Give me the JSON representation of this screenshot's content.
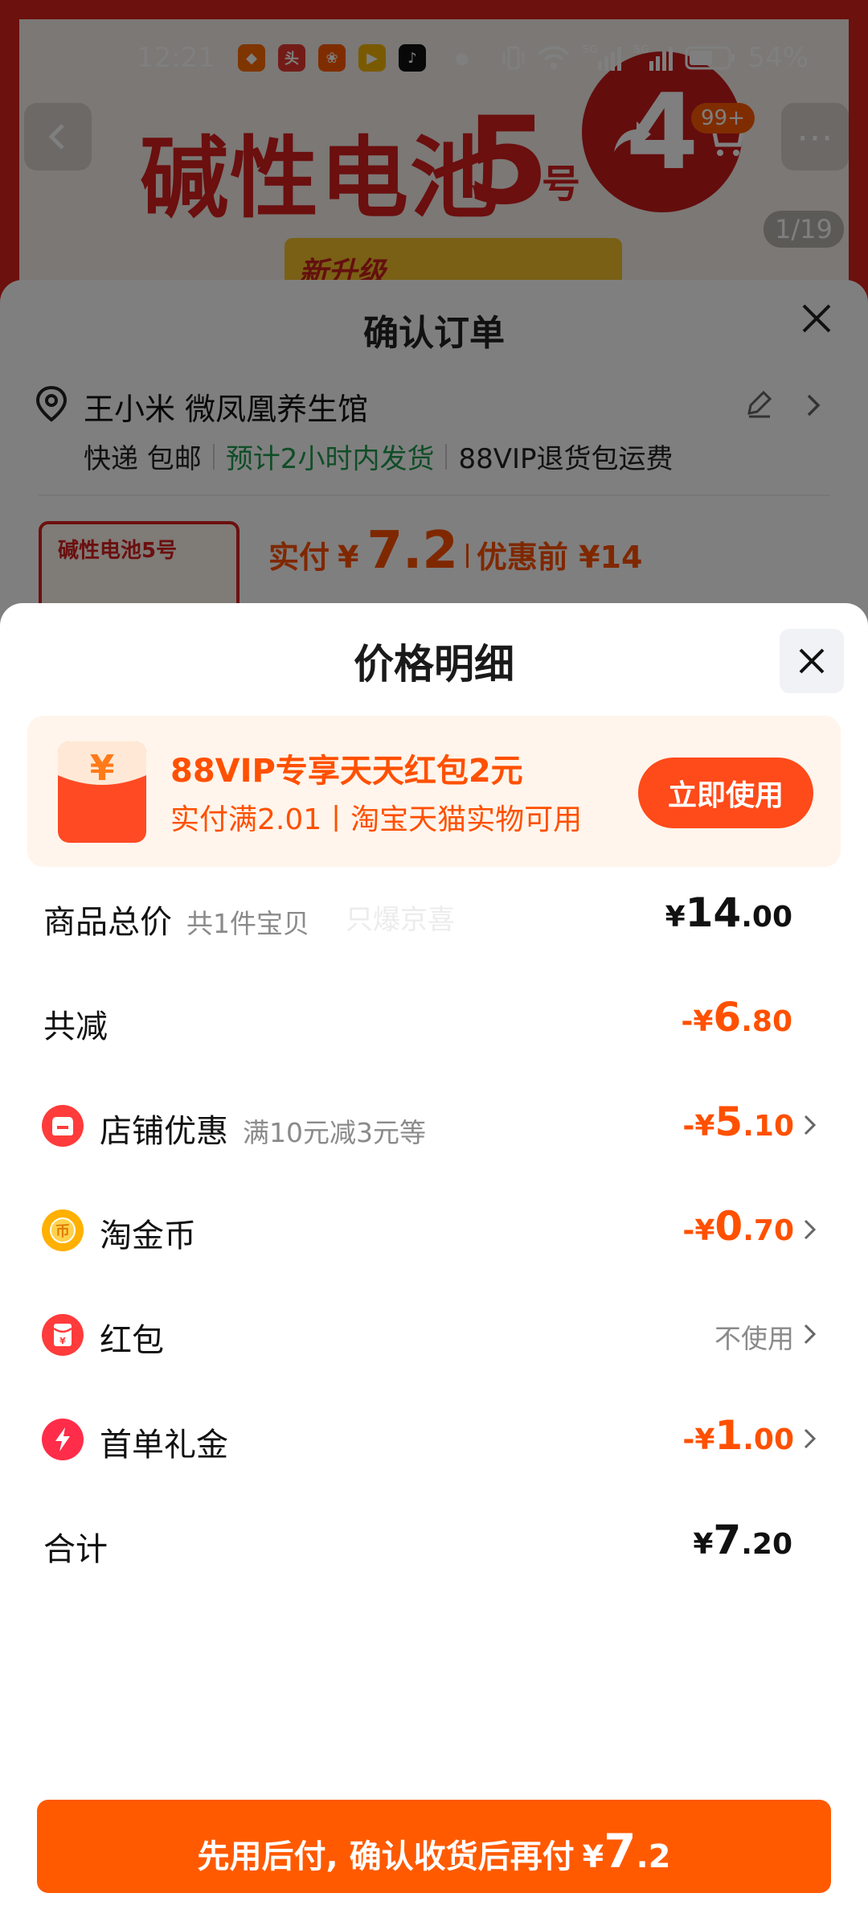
{
  "status_bar": {
    "time": "12:21",
    "app_icons": [
      {
        "name": "taobao-icon",
        "color": "#ff6a00",
        "glyph": "◆"
      },
      {
        "name": "toutiao-icon",
        "color": "#e7382f",
        "glyph": "头"
      },
      {
        "name": "kuaishou-icon",
        "color": "#ff5a00",
        "glyph": "❀"
      },
      {
        "name": "video-app-icon",
        "color": "#f4b400",
        "glyph": "▶"
      },
      {
        "name": "douyin-icon",
        "color": "#111111",
        "glyph": "♪"
      }
    ],
    "battery": "54%"
  },
  "background": {
    "banner_title": "碱性电池",
    "banner_five": "5",
    "banner_hao": "号",
    "banner_circle": "4",
    "banner_tag": "新升级",
    "cart_badge": "99+",
    "image_counter": "1/19"
  },
  "order": {
    "title": "确认订单",
    "address_name": "王小米 微凤凰养生馆",
    "shipping": "快递 包邮",
    "ship_time": "预计2小时内发货",
    "return_info": "88VIP退货包运费",
    "thumb_title": "碱性电池5号",
    "pay_label": "实付",
    "pay_currency": "¥",
    "pay_amount": "7.2",
    "before_label": "优惠前 ¥14"
  },
  "sheet": {
    "title": "价格明细",
    "promo": {
      "title": "88VIP专享天天红包2元",
      "subtitle": "实付满2.01丨淘宝天猫实物可用",
      "button": "立即使用"
    },
    "rows": [
      {
        "label": "商品总价",
        "note": "共1件宝贝",
        "sign": "¥",
        "int": "14",
        "dec": ".00",
        "style": "black"
      },
      {
        "label": "共减",
        "note": "",
        "sign": "-¥",
        "int": "6",
        "dec": ".80",
        "style": "orange"
      },
      {
        "label": "店铺优惠",
        "note": "满10元减3元等",
        "sign": "-¥",
        "int": "5",
        "dec": ".10",
        "style": "orange",
        "icon": "shop-icon"
      },
      {
        "label": "淘金币",
        "note": "",
        "sign": "-¥",
        "int": "0",
        "dec": ".70",
        "style": "orange",
        "icon": "coin-icon"
      },
      {
        "label": "红包",
        "note": "",
        "text": "不使用",
        "style": "grey",
        "icon": "red-packet-icon"
      },
      {
        "label": "首单礼金",
        "note": "",
        "sign": "-¥",
        "int": "1",
        "dec": ".00",
        "style": "orange",
        "icon": "lightning-icon"
      },
      {
        "label": "合计",
        "note": "",
        "sign": "¥",
        "int": "7",
        "dec": ".20",
        "style": "black"
      }
    ],
    "watermark": "只爆京喜",
    "bottom_button": {
      "text": "先用后付, 确认收货后再付",
      "currency": "¥",
      "int": "7",
      "dec": ".2"
    }
  },
  "colors": {
    "accent": "#ff5000",
    "button": "#ff5a00",
    "green": "#1e9b4e",
    "banner_red": "#d8231d"
  }
}
